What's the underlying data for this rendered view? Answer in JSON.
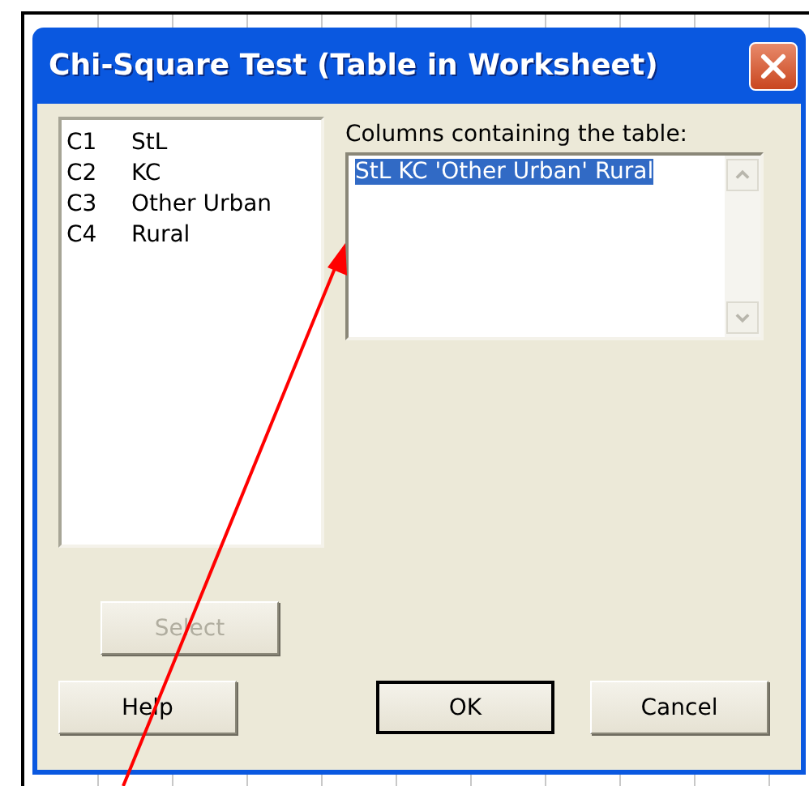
{
  "window": {
    "title": "Chi-Square Test (Table in Worksheet)"
  },
  "variables": [
    {
      "column": "C1",
      "name": "StL"
    },
    {
      "column": "C2",
      "name": "KC"
    },
    {
      "column": "C3",
      "name": "Other Urban"
    },
    {
      "column": "C4",
      "name": "Rural"
    }
  ],
  "table_columns": {
    "label": "Columns containing the table:",
    "value": "StL KC 'Other Urban' Rural",
    "highlighted": true
  },
  "buttons": [
    {
      "kind": "select",
      "label": "Select",
      "disabled": true,
      "default": false
    },
    {
      "kind": "help",
      "label": "Help",
      "disabled": false,
      "default": false
    },
    {
      "kind": "ok",
      "label": "OK",
      "disabled": false,
      "default": true
    },
    {
      "kind": "cancel",
      "label": "Cancel",
      "disabled": false,
      "default": false
    }
  ],
  "annotation": {
    "kind": "arrow"
  }
}
